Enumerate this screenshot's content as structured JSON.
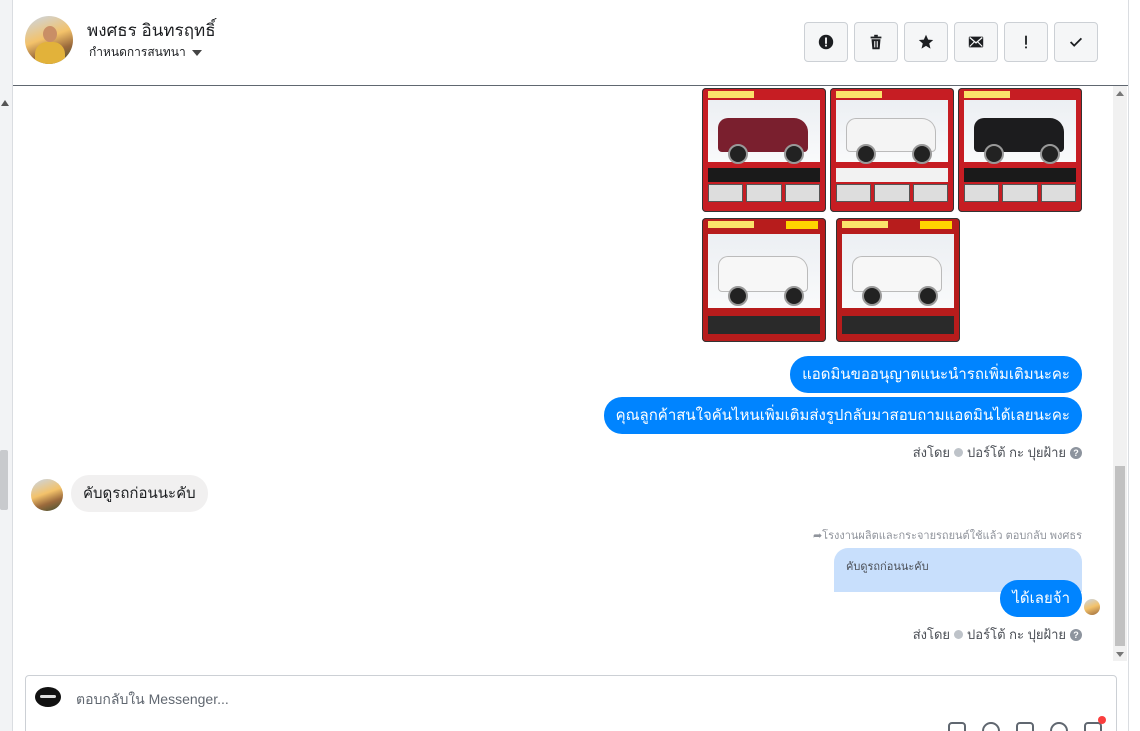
{
  "header": {
    "contact_name": "พงศธร อินทรฤทธิ์",
    "subtitle": "กำหนดการสนทนา",
    "actions": [
      {
        "name": "report-spam-icon",
        "label": "spam"
      },
      {
        "name": "trash-icon",
        "label": "delete"
      },
      {
        "name": "star-icon",
        "label": "star"
      },
      {
        "name": "envelope-icon",
        "label": "mark-unread"
      },
      {
        "name": "exclamation-icon",
        "label": "follow-up"
      },
      {
        "name": "check-icon",
        "label": "done"
      }
    ]
  },
  "thread": {
    "photos": [
      {
        "body_color": "#7a1f2e"
      },
      {
        "body_color": "#f4f4f4"
      },
      {
        "body_color": "#1c1c1e"
      },
      {
        "body_color": "#f7f7f7"
      },
      {
        "body_color": "#f7f7f7"
      }
    ],
    "outgoing_1": "แอดมินขออนุญาตแนะนำรถเพิ่มเติมนะคะ",
    "outgoing_2": "คุณลูกค้าสนใจคันไหนเพิ่มเติมส่งรูปกลับมาสอบถามแอดมินได้เลยนะคะ",
    "sent_by_1": "ส่งโดย",
    "sender_1": "ปอร์โต้ กะ ปุยฝ้าย",
    "incoming_1": "คับดูรถก่อนนะคับ",
    "reply_note": "โรงงานผลิตและกระจายรถยนต์ใช้แล้ว ตอบกลับ พงศธร",
    "quoted_text": "คับดูรถก่อนนะคับ",
    "outgoing_3": "ได้เลยจ้า",
    "sent_by_2": "ส่งโดย",
    "sender_2": "ปอร์โต้ กะ ปุยฝ้าย"
  },
  "composer": {
    "placeholder": "ตอบกลับใน Messenger..."
  },
  "colors": {
    "accent": "#0084ff",
    "incoming_bubble": "#f1f0f0",
    "quoted_bubble": "#c8dffc",
    "photo_frame": "#c61d23"
  }
}
